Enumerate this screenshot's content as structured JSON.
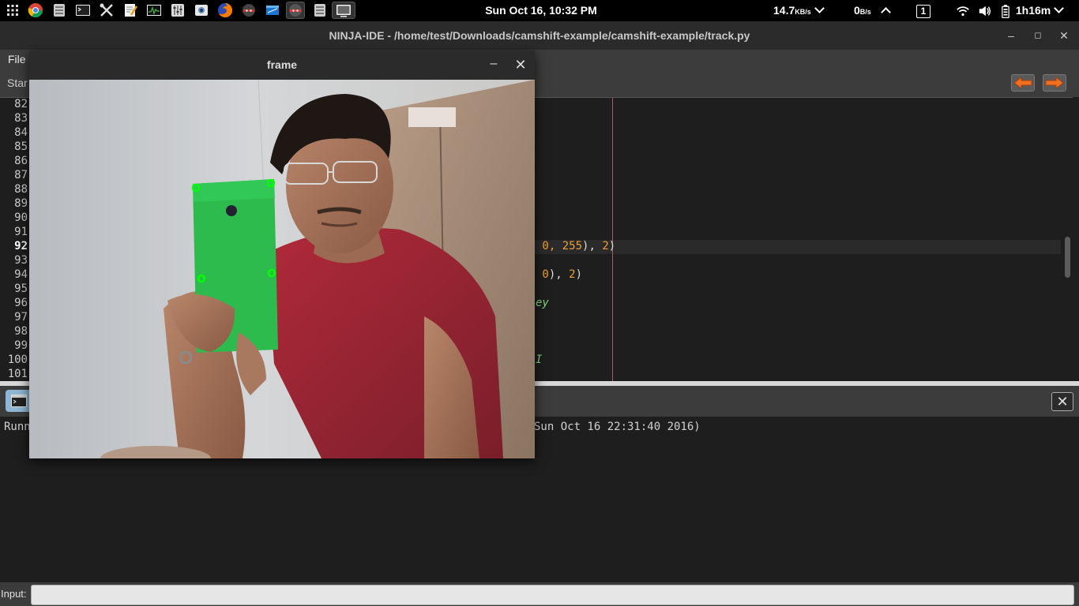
{
  "panel": {
    "clock": "Sun Oct 16, 10:32 PM",
    "download_rate": "14.7",
    "download_unit": "KB/s",
    "upload_rate": "0",
    "upload_unit": "B/s",
    "workspace": "1",
    "battery": "1h16m"
  },
  "launchers": [
    "apps-grid-icon",
    "chrome-icon",
    "files-icon",
    "terminal-icon",
    "tools-icon",
    "text-editor-icon",
    "system-monitor-icon",
    "audio-mixer-icon",
    "screenshot-icon",
    "firefox-icon",
    "ninja-ide-icon",
    "virtualbox-icon",
    "ninja-ide-active-icon",
    "files-icon",
    "display-icon"
  ],
  "ide": {
    "title": "NINJA-IDE - /home/test/Downloads/camshift-example/camshift-example/track.py",
    "menu_file": "File",
    "tab_start": "Star",
    "minimize": "–",
    "maximize": "◻",
    "close": "✕"
  },
  "editor": {
    "line_numbers": [
      "82",
      "83",
      "84",
      "85",
      "86",
      "87",
      "88",
      "89",
      "90",
      "91",
      "92",
      "93",
      "94",
      "95",
      "96",
      "97",
      "98",
      "99",
      "100",
      "101"
    ],
    "current_line": "92",
    "code_line_92_a": " 0, 255",
    "code_line_92_b": "), ",
    "code_line_92_c": "2",
    "code_line_92_d": ")",
    "code_line_94_a": " 0",
    "code_line_94_b": "), ",
    "code_line_94_c": "2",
    "code_line_94_d": ")",
    "code_line_96": "ey",
    "code_line_100": "I"
  },
  "console": {
    "left_text": "Runn",
    "right_text": "Sun Oct 16 22:31:40 2016)",
    "close": "✕",
    "input_label": "Input:",
    "input_value": ""
  },
  "frame": {
    "title": "frame",
    "minimize": "–",
    "close": "✕"
  },
  "colors": {
    "panel_bg": "#000000",
    "editor_bg": "#1e1e1e",
    "number_color": "#f0a030",
    "comment_color": "#7fd67f",
    "tracking_point": "#00ff00"
  }
}
